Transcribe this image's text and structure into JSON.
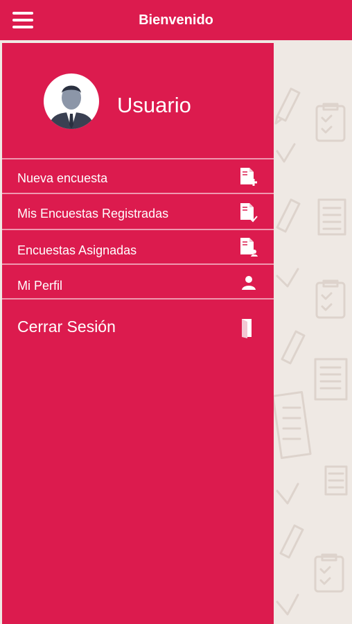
{
  "header": {
    "title": "Bienvenido",
    "menu_icon": "hamburger-menu-icon"
  },
  "colors": {
    "primary": "#dc1b4e",
    "background": "#efe9e4",
    "pattern": "#ddd3cc"
  },
  "profile": {
    "username": "Usuario",
    "avatar_icon": "user-avatar-icon"
  },
  "menu": [
    {
      "label": "Nueva encuesta",
      "icon": "new-document-icon"
    },
    {
      "label": "Mis Encuestas Registradas",
      "icon": "document-check-icon"
    },
    {
      "label": "Encuestas Asignadas",
      "icon": "assigned-document-icon"
    },
    {
      "label": "Mi Perfil",
      "icon": "person-icon"
    },
    {
      "label": "Cerrar Sesión",
      "icon": "door-icon"
    }
  ]
}
